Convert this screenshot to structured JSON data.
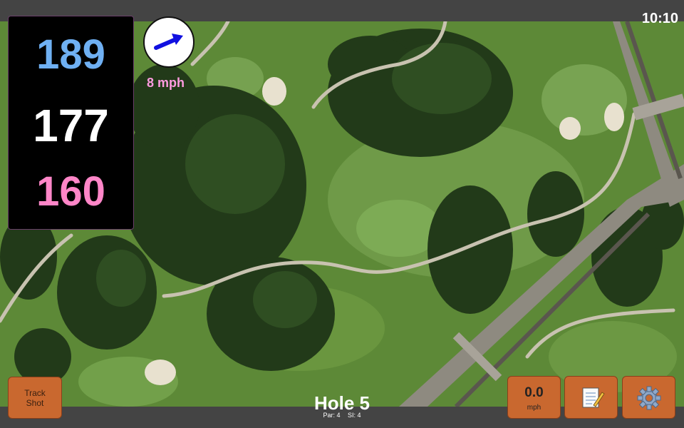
{
  "status": {
    "time": "10:10"
  },
  "distances": {
    "back": "189",
    "middle": "177",
    "front": "160"
  },
  "wind": {
    "speed_label": "8 mph",
    "icon": "wind-arrow-icon",
    "color": "#1010e0"
  },
  "buttons": {
    "track_shot": [
      "Track",
      "Shot"
    ],
    "speed_value": "0.0",
    "speed_unit": "mph",
    "notes_icon": "notepad-icon",
    "settings_icon": "gear-icon"
  },
  "hole": {
    "title": "Hole 5",
    "par": "Par: 4",
    "si": "SI: 4"
  },
  "colors": {
    "button": "#c9682f",
    "back_distance": "#6fb0f3",
    "front_distance": "#ff86c8",
    "wind_text": "#ff9be0"
  }
}
